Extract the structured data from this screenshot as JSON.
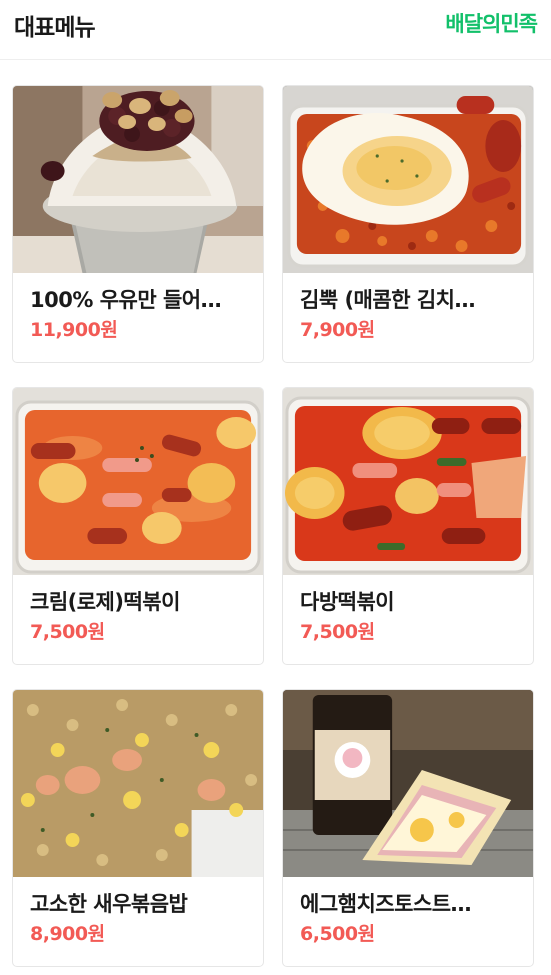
{
  "header": {
    "title": "대표메뉴",
    "brand": "배달의민족"
  },
  "menu": [
    {
      "name": "100% 우유만 들어…",
      "price": "11,900원",
      "image": "bingsu-photo"
    },
    {
      "name": "김뿍 (매콤한 김치…",
      "price": "7,900원",
      "image": "kimchi-fried-rice-photo"
    },
    {
      "name": "크림(로제)떡볶이",
      "price": "7,500원",
      "image": "rose-tteokbokki-photo"
    },
    {
      "name": "다방떡볶이",
      "price": "7,500원",
      "image": "dabang-tteokbokki-photo"
    },
    {
      "name": "고소한 새우볶음밥",
      "price": "8,900원",
      "image": "shrimp-fried-rice-photo"
    },
    {
      "name": "에그햄치즈토스트…",
      "price": "6,500원",
      "image": "egg-ham-cheese-toast-photo"
    }
  ],
  "colors": {
    "brand": "#12c06a",
    "price": "#f25a55"
  }
}
